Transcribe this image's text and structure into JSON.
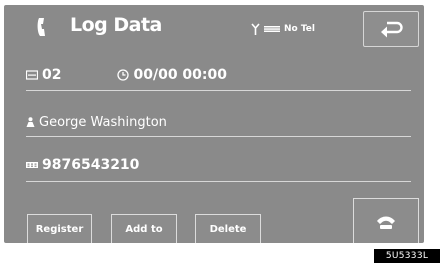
{
  "header": {
    "title": "Log Data",
    "title_icon": "phone-handset-icon",
    "status": {
      "antenna_icon": "antenna-icon",
      "signal_icon": "signal-bars-icon",
      "label": "No Tel"
    },
    "back_icon": "back-arrow-icon"
  },
  "entry": {
    "index": "02",
    "index_icon": "speed-dial-icon",
    "time": "00/00 00:00",
    "time_icon": "clock-icon",
    "name": "George Washington",
    "name_icon": "person-icon",
    "number": "9876543210",
    "number_icon": "phone-number-icon"
  },
  "buttons": {
    "register": "Register",
    "add_to": "Add to",
    "delete": "Delete",
    "call_icon": "phone-call-icon"
  },
  "figure_code": "5U5333L",
  "colors": {
    "screen": "#8a8a8a",
    "text": "#ffffff",
    "divider": "#d7d7d7"
  }
}
